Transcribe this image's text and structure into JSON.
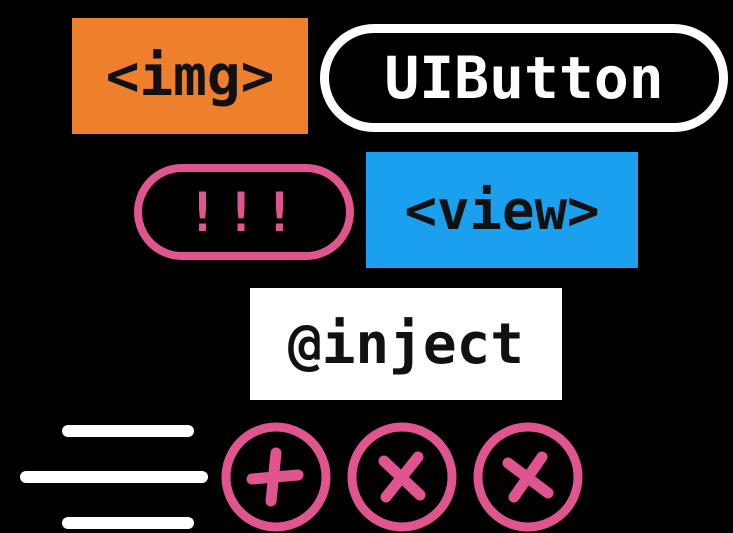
{
  "colors": {
    "background": "#000000",
    "orange": "#ee7f2d",
    "blue": "#1aa0ef",
    "pink": "#e0548f",
    "white": "#ffffff",
    "text_dark": "#111111"
  },
  "tags": {
    "img": "<img>",
    "uibutton": "UIButton",
    "bang": "!!!",
    "view": "<view>",
    "inject": "@inject"
  },
  "icons": {
    "speed_lines": "speed-lines-icon",
    "circle_1": "plus-circle-icon",
    "circle_2": "close-circle-icon",
    "circle_3": "close-circle-icon"
  }
}
